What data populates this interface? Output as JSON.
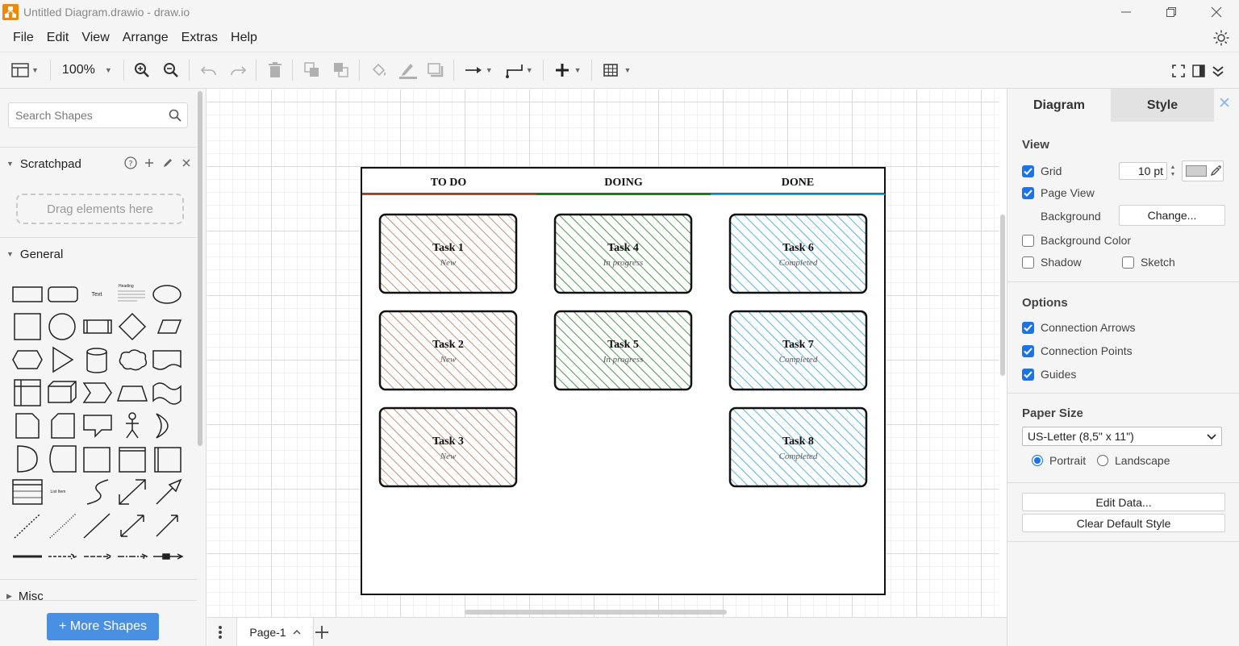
{
  "window": {
    "title": "Untitled Diagram.drawio - draw.io"
  },
  "menu": [
    "File",
    "Edit",
    "View",
    "Arrange",
    "Extras",
    "Help"
  ],
  "toolbar": {
    "zoom": "100%"
  },
  "sidebar": {
    "search_placeholder": "Search Shapes",
    "scratchpad_label": "Scratchpad",
    "scratchpad_drop_hint": "Drag elements here",
    "general_label": "General",
    "misc_label": "Misc",
    "more_shapes_label": "+ More Shapes",
    "shape_text_label": "Text",
    "shape_heading_label": "Heading",
    "shape_list_item_label": "List Item"
  },
  "board": {
    "columns": [
      "TO DO",
      "DOING",
      "DONE"
    ],
    "column_colors": [
      "#a0522d",
      "#1e7b1e",
      "#2a9fd6"
    ],
    "cards": [
      {
        "title": "Task 1",
        "status": "New",
        "column": 0
      },
      {
        "title": "Task 2",
        "status": "New",
        "column": 0
      },
      {
        "title": "Task 3",
        "status": "New",
        "column": 0
      },
      {
        "title": "Task 4",
        "status": "In progress",
        "column": 1
      },
      {
        "title": "Task 5",
        "status": "In progress",
        "column": 1
      },
      {
        "title": "Task 6",
        "status": "Completed",
        "column": 2
      },
      {
        "title": "Task 7",
        "status": "Completed",
        "column": 2
      },
      {
        "title": "Task 8",
        "status": "Completed",
        "column": 2
      }
    ]
  },
  "pages": {
    "current": "Page-1"
  },
  "format_panel": {
    "tabs": [
      "Diagram",
      "Style"
    ],
    "view": {
      "section_label": "View",
      "grid_label": "Grid",
      "grid_checked": true,
      "grid_size": "10 pt",
      "page_view_label": "Page View",
      "page_view_checked": true,
      "background_label": "Background",
      "change_button": "Change...",
      "background_color_label": "Background Color",
      "background_color_checked": false,
      "shadow_label": "Shadow",
      "shadow_checked": false,
      "sketch_label": "Sketch",
      "sketch_checked": false
    },
    "options": {
      "section_label": "Options",
      "connection_arrows_label": "Connection Arrows",
      "connection_points_label": "Connection Points",
      "guides_label": "Guides"
    },
    "paper": {
      "section_label": "Paper Size",
      "selected": "US-Letter (8,5\" x 11\")",
      "portrait_label": "Portrait",
      "landscape_label": "Landscape",
      "orientation": "Portrait"
    },
    "edit_data_button": "Edit Data...",
    "clear_default_style_button": "Clear Default Style"
  }
}
